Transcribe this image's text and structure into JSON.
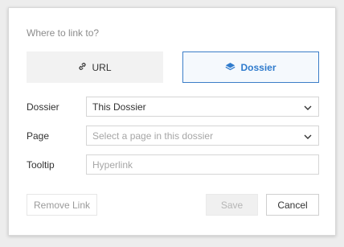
{
  "dialog": {
    "prompt": "Where to link to?",
    "link_types": [
      {
        "label": "URL",
        "icon": "link-icon",
        "selected": false
      },
      {
        "label": "Dossier",
        "icon": "dossier-icon",
        "selected": true
      }
    ],
    "fields": {
      "dossier": {
        "label": "Dossier",
        "value": "This Dossier"
      },
      "page": {
        "label": "Page",
        "placeholder": "Select a page in this dossier"
      },
      "tooltip": {
        "label": "Tooltip",
        "placeholder": "Hyperlink"
      }
    },
    "buttons": {
      "remove": "Remove Link",
      "save": "Save",
      "cancel": "Cancel"
    }
  },
  "colors": {
    "accent": "#2f7bcd",
    "selected_border": "#3c7ec8",
    "placeholder": "#a6a6a6",
    "disabled_text": "#b5b5b5"
  }
}
